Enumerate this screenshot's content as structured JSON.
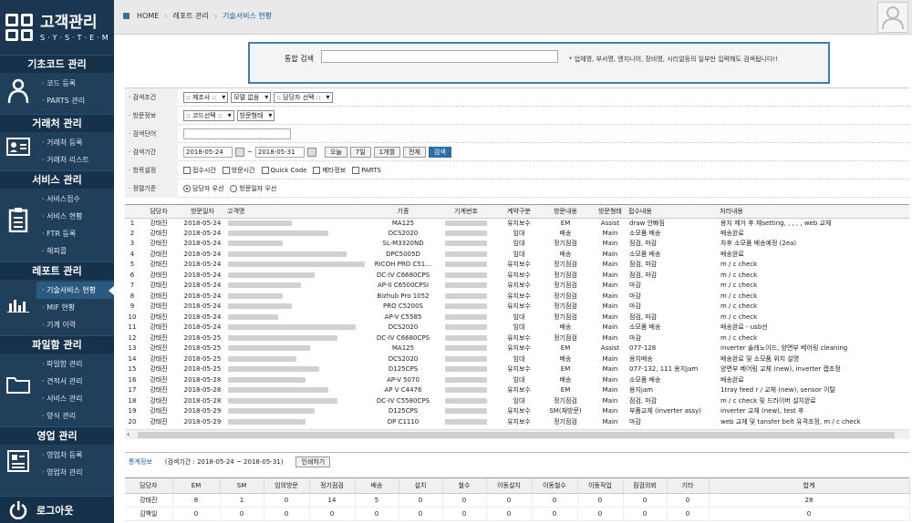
{
  "app": {
    "title": "고객관리",
    "subtitle": "S·Y·S·T·E·M"
  },
  "sidebar": {
    "sections": [
      {
        "title": "기초코드 관리",
        "icon": "person-icon",
        "items": [
          "· 코드 등록",
          "· PARTS 관리"
        ]
      },
      {
        "title": "거래처 관리",
        "icon": "id-card-icon",
        "items": [
          "· 거래처 등록",
          "· 거래처 리스트"
        ]
      },
      {
        "title": "서비스 관리",
        "icon": "clipboard-icon",
        "items": [
          "· 서비스접수",
          "· 서비스 현황",
          "· FTR 등록",
          "· 해피콜"
        ]
      },
      {
        "title": "레포트 관리",
        "icon": "bar-chart-icon",
        "items": [
          "· 기술서비스 현황",
          "· MIF 현황",
          "· 기계 이력"
        ],
        "active": 0
      },
      {
        "title": "파일함 관리",
        "icon": "folder-icon",
        "items": [
          "· 파일함 관리",
          "· 견적서 관리",
          "· 서비스 관리",
          "· 양식 관리"
        ]
      },
      {
        "title": "영업 관리",
        "icon": "document-icon",
        "items": [
          "· 영업처 등록",
          "· 영업처 관리"
        ]
      }
    ],
    "logout": "로그아웃"
  },
  "breadcrumb": {
    "home": "HOME",
    "level1": "레포트 관리",
    "current": "기술서비스 현황"
  },
  "search": {
    "label": "통합 검색",
    "value": "",
    "hint": "* 업체명, 부서명, 엔지니어, 장비명, 시리얼등의 일부만 입력해도 검색됩니다!!"
  },
  "filters": {
    "search_cond": {
      "label": "· 검색조건",
      "maker": ":: 제조사 ::",
      "model": "모델 없음",
      "manager": ":: 담당자 선택 ::"
    },
    "visit_info": {
      "label": "· 방문정보",
      "code": ":: 코드선택 ::",
      "type": "방문형태"
    },
    "keyword": {
      "label": "· 검색단어",
      "value": ""
    },
    "period": {
      "label": "· 검색기간",
      "from": "2018-05-24",
      "tilde": "~",
      "to": "2018-05-31",
      "btn_today": "오늘",
      "btn_7": "7일",
      "btn_month": "1개월",
      "btn_all": "전체",
      "btn_search": "검색"
    },
    "items": {
      "label": "· 항목설정",
      "options": [
        "접수시간",
        "방문시간",
        "Quick Code",
        "메타정보",
        "PARTS"
      ]
    },
    "sort": {
      "label": "· 정렬기준",
      "options": [
        "담당자 우선",
        "방문일자 우선"
      ],
      "selected": 0
    }
  },
  "table": {
    "columns": [
      "",
      "담당자",
      "방문일자",
      "고객명",
      "기종",
      "기계번호",
      "계약구분",
      "방문내용",
      "방문형태",
      "접수내용",
      "처리내용"
    ],
    "rows": [
      [
        "1",
        "강태진",
        "2018-05-24",
        "",
        "MA125",
        "",
        "유지보수",
        "EM",
        "Assist",
        "draw 안빠짐",
        "용지 제거 후 재setting, , , , , web 교체"
      ],
      [
        "2",
        "강태진",
        "2018-05-24",
        "",
        "DCS2020",
        "",
        "임대",
        "배송",
        "Main",
        "소모품 배송",
        "배송완료"
      ],
      [
        "3",
        "강태진",
        "2018-05-24",
        "",
        "SL-M3320ND",
        "",
        "임대",
        "정기점검",
        "Main",
        "점검, 마감",
        "차후 소모품 배송예정 (2ea)"
      ],
      [
        "4",
        "강태진",
        "2018-05-24",
        "",
        "DPC5005D",
        "",
        "임대",
        "배송",
        "Main",
        "소모품 배송",
        "배송완료"
      ],
      [
        "5",
        "강태진",
        "2018-05-24",
        "",
        "RICOH PRO C51…",
        "",
        "유지보수",
        "정기점검",
        "Main",
        "점검, 마감",
        "m / c check"
      ],
      [
        "6",
        "강태진",
        "2018-05-24",
        "",
        "DC-IV C6680CPS",
        "",
        "유지보수",
        "정기점검",
        "Main",
        "점검, 마감",
        "m / c check"
      ],
      [
        "7",
        "강태진",
        "2018-05-24",
        "",
        "AP-II C6500CPSI",
        "",
        "유지보수",
        "정기점검",
        "Main",
        "마감",
        "m / c check"
      ],
      [
        "8",
        "강태진",
        "2018-05-24",
        "",
        "Bizhub Pro 1052",
        "",
        "유지보수",
        "정기점검",
        "Main",
        "마감",
        "m / c check"
      ],
      [
        "9",
        "강태진",
        "2018-05-24",
        "",
        "PRO C5200S",
        "",
        "유지보수",
        "정기점검",
        "Main",
        "마감",
        "m / c check"
      ],
      [
        "10",
        "강태진",
        "2018-05-24",
        "",
        "AP-V C5585",
        "",
        "임대",
        "정기점검",
        "Main",
        "점검, 마감",
        "m / c check"
      ],
      [
        "11",
        "강태진",
        "2018-05-24",
        "",
        "DCS2020",
        "",
        "임대",
        "배송",
        "Main",
        "소모품 배송",
        "배송완료 - usb선"
      ],
      [
        "12",
        "강태진",
        "2018-05-25",
        "",
        "DC-IV C6680CPS",
        "",
        "유지보수",
        "정기점검",
        "Main",
        "마감",
        "m / c check"
      ],
      [
        "13",
        "강태진",
        "2018-05-25",
        "",
        "MA125",
        "",
        "유지보수",
        "EM",
        "Assist",
        "077-128",
        "inverter 솔레노이드, 양면부 베어링 cleaning"
      ],
      [
        "14",
        "강태진",
        "2018-05-25",
        "",
        "DCS2020",
        "",
        "임대",
        "배송",
        "Main",
        "용지배송",
        "배송완료 및 소모품 위치 설명"
      ],
      [
        "15",
        "강태진",
        "2018-05-25",
        "",
        "D125CPS",
        "",
        "유지보수",
        "EM",
        "Main",
        "077-132, 111 용지jam",
        "양면부 베어링 교체 (new), inverter 캡조정"
      ],
      [
        "16",
        "강태진",
        "2018-05-28",
        "",
        "AP-V 5070",
        "",
        "임대",
        "배송",
        "Main",
        "소모품 배송",
        "배송완료"
      ],
      [
        "17",
        "강태진",
        "2018-05-28",
        "",
        "AP V C4476",
        "",
        "유지보수",
        "EM",
        "Main",
        "용지jam",
        "1tray feed r / 교체 (new), sensor 이탈"
      ],
      [
        "18",
        "강태진",
        "2018-05-28",
        "",
        "DC-IV C5580CPS",
        "",
        "임대",
        "정기점검",
        "Main",
        "점검, 마감",
        "m / c check 및 드라이버 설치완료"
      ],
      [
        "19",
        "강태진",
        "2018-05-29",
        "",
        "D125CPS",
        "",
        "유지보수",
        "SM(재방문)",
        "Main",
        "부품교체 (inverter assy)",
        "inverter 교체 (new), test 후"
      ],
      [
        "20",
        "강태진",
        "2018-05-29",
        "",
        "DP C1110",
        "",
        "유지보수",
        "정기점검",
        "Main",
        "마감",
        "web 교체 및 tansfer belt 유격조정, m / c check"
      ]
    ]
  },
  "stats": {
    "title": "통계정보",
    "period": "(검색기간 : 2018-05-24 ~ 2018-05-31)",
    "print": "인쇄하기",
    "columns": [
      "담당자",
      "EM",
      "SM",
      "임의방문",
      "정기점검",
      "배송",
      "설치",
      "철수",
      "이동설치",
      "이동철수",
      "이동작업",
      "점검의뢰",
      "기타",
      "합계"
    ],
    "rows": [
      [
        "강태진",
        "8",
        "1",
        "0",
        "14",
        "5",
        "0",
        "0",
        "0",
        "0",
        "0",
        "0",
        "0",
        "28"
      ],
      [
        "김백일",
        "0",
        "0",
        "0",
        "0",
        "0",
        "0",
        "0",
        "0",
        "0",
        "0",
        "0",
        "0",
        "0"
      ]
    ]
  },
  "colors": {
    "sidebar": "#1f3f5a",
    "accent": "#2f6da6",
    "search_border": "#3f7fb3"
  }
}
